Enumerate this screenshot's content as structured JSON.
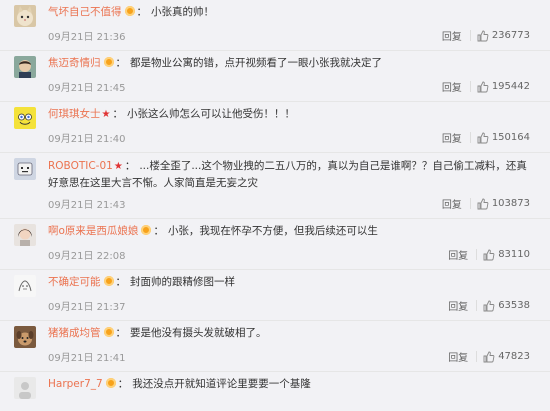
{
  "reply_label": "回复",
  "colors": {
    "username": "#eb7350",
    "star": "#e03434",
    "background": "#f2f2f5"
  },
  "comments": [
    {
      "user": "气坏自己不值得",
      "badge": "vip",
      "text": "小张真的帅！",
      "time": "09月21日 21:36",
      "likes": "236773",
      "avatar": "cat-avatar"
    },
    {
      "user": "焦迈奇情归",
      "badge": "vip",
      "text": "都是物业公寓的错，点开视频看了一眼小张我就决定了",
      "time": "09月21日 21:45",
      "likes": "195442",
      "avatar": "person-avatar"
    },
    {
      "user": "何琪琪女士",
      "badge": "star",
      "star_glyph": "★",
      "text": "小张这么帅怎么可以让他受伤！！！",
      "time": "09月21日 21:40",
      "likes": "150164",
      "avatar": "sponge-avatar"
    },
    {
      "user": "ROBOTIC-01",
      "badge": "star",
      "star_glyph": "★",
      "text": "...楼全歪了...这个物业拽的二五八万的，真以为自己是谁啊？？自己偷工减料，还真好意思在这里大言不惭。人家简直是无妄之灾",
      "time": "09月21日 21:43",
      "likes": "103873",
      "avatar": "cartoon-avatar"
    },
    {
      "user": "啊o原来是西瓜娘娘",
      "badge": "vip",
      "text": "小张，我现在怀孕不方便，但我后续还可以生",
      "time": "09月21日 22:08",
      "likes": "83110",
      "avatar": "girl-avatar"
    },
    {
      "user": "不确定可能",
      "badge": "vip",
      "text": "封面帅的跟精修图一样",
      "time": "09月21日 21:37",
      "likes": "63538",
      "avatar": "sketch-avatar"
    },
    {
      "user": "猪猪成均管",
      "badge": "vip",
      "text": "要是他没有摄头发就破相了。",
      "time": "09月21日 21:41",
      "likes": "47823",
      "avatar": "dog-avatar"
    },
    {
      "user": "Harper7_7",
      "badge": "vip",
      "text": "我还没点开就知道评论里要要一个基隆",
      "time": "",
      "likes": "",
      "avatar": "blank-avatar"
    }
  ]
}
